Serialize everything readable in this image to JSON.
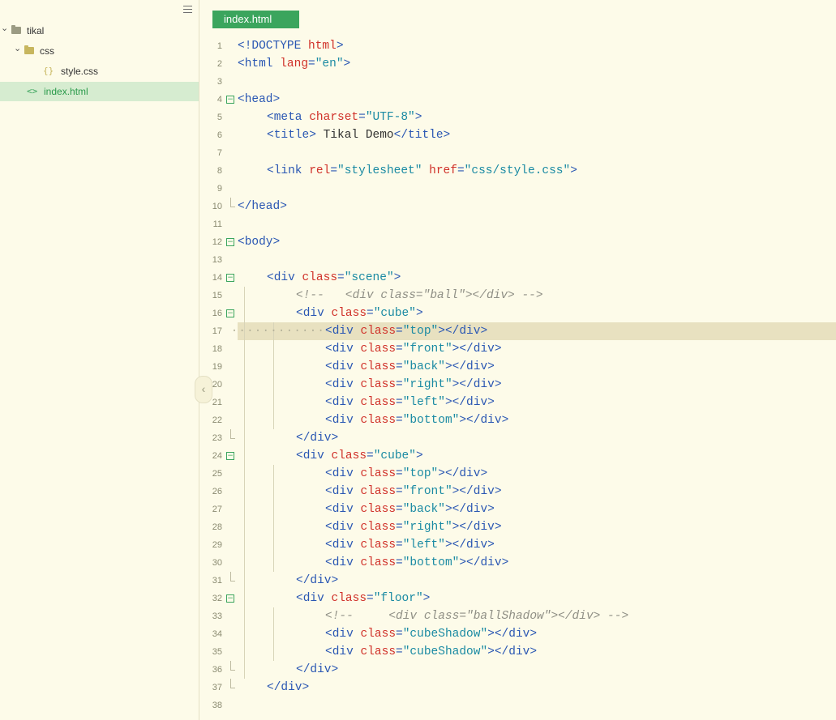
{
  "sidebar": {
    "tree": [
      {
        "label": "tikal",
        "chevron": "⌄",
        "icon": "folder-icon",
        "level": 0
      },
      {
        "label": "css",
        "chevron": "⌄",
        "icon": "folder-open-icon",
        "level": 1
      },
      {
        "label": "style.css",
        "chevron": "",
        "icon": "css-file-icon",
        "glyph": "{}",
        "level": 2
      },
      {
        "label": "index.html",
        "chevron": "",
        "icon": "html-file-icon",
        "glyph": "<>",
        "level": 1,
        "active": true
      }
    ],
    "collapse_glyph": "‹"
  },
  "tab": {
    "label": "index.html"
  },
  "editor": {
    "highlighted_line": 17,
    "lines": [
      {
        "n": "1",
        "indent": 0,
        "tokens": [
          [
            "tag",
            "<!DOCTYPE "
          ],
          [
            "attr",
            "html"
          ],
          [
            "tag",
            ">"
          ]
        ]
      },
      {
        "n": "2",
        "indent": 0,
        "tokens": [
          [
            "tag",
            "<html "
          ],
          [
            "attr",
            "lang"
          ],
          [
            "tag",
            "="
          ],
          [
            "str",
            "\"en\""
          ],
          [
            "tag",
            ">"
          ]
        ]
      },
      {
        "n": "3",
        "indent": 0,
        "tokens": []
      },
      {
        "n": "4",
        "indent": 0,
        "fold": "open",
        "tokens": [
          [
            "tag",
            "<head>"
          ]
        ]
      },
      {
        "n": "5",
        "indent": 1,
        "tokens": [
          [
            "tag",
            "<meta "
          ],
          [
            "attr",
            "charset"
          ],
          [
            "tag",
            "="
          ],
          [
            "str",
            "\"UTF-8\""
          ],
          [
            "tag",
            ">"
          ]
        ]
      },
      {
        "n": "6",
        "indent": 1,
        "tokens": [
          [
            "tag",
            "<title>"
          ],
          [
            "txt",
            " Tikal Demo"
          ],
          [
            "tag",
            "</title>"
          ]
        ]
      },
      {
        "n": "7",
        "indent": 0,
        "tokens": []
      },
      {
        "n": "8",
        "indent": 1,
        "tokens": [
          [
            "tag",
            "<link "
          ],
          [
            "attr",
            "rel"
          ],
          [
            "tag",
            "="
          ],
          [
            "str",
            "\"stylesheet\""
          ],
          [
            "txt",
            " "
          ],
          [
            "attr",
            "href"
          ],
          [
            "tag",
            "="
          ],
          [
            "str",
            "\"css/style.css\""
          ],
          [
            "tag",
            ">"
          ]
        ]
      },
      {
        "n": "9",
        "indent": 0,
        "tokens": []
      },
      {
        "n": "10",
        "indent": 0,
        "fold": "end",
        "tokens": [
          [
            "tag",
            "</head>"
          ]
        ]
      },
      {
        "n": "11",
        "indent": 0,
        "tokens": []
      },
      {
        "n": "12",
        "indent": 0,
        "fold": "open",
        "tokens": [
          [
            "tag",
            "<body>"
          ]
        ]
      },
      {
        "n": "13",
        "indent": 0,
        "tokens": []
      },
      {
        "n": "14",
        "indent": 1,
        "fold": "open",
        "tokens": [
          [
            "tag",
            "<div "
          ],
          [
            "attr",
            "class"
          ],
          [
            "tag",
            "="
          ],
          [
            "str",
            "\"scene\""
          ],
          [
            "tag",
            ">"
          ]
        ]
      },
      {
        "n": "15",
        "indent": 2,
        "tokens": [
          [
            "cmt",
            "<!--   <div class=\"ball\"></div> -->"
          ]
        ]
      },
      {
        "n": "16",
        "indent": 2,
        "fold": "open",
        "tokens": [
          [
            "tag",
            "<div "
          ],
          [
            "attr",
            "class"
          ],
          [
            "tag",
            "="
          ],
          [
            "str",
            "\"cube\""
          ],
          [
            "tag",
            ">"
          ]
        ]
      },
      {
        "n": "17",
        "indent": 3,
        "dots": true,
        "tokens": [
          [
            "tag",
            "<div "
          ],
          [
            "attr",
            "class"
          ],
          [
            "tag",
            "="
          ],
          [
            "str",
            "\"top\""
          ],
          [
            "tag",
            "></div>"
          ]
        ]
      },
      {
        "n": "18",
        "indent": 3,
        "tokens": [
          [
            "tag",
            "<div "
          ],
          [
            "attr",
            "class"
          ],
          [
            "tag",
            "="
          ],
          [
            "str",
            "\"front\""
          ],
          [
            "tag",
            "></div>"
          ]
        ]
      },
      {
        "n": "19",
        "indent": 3,
        "tokens": [
          [
            "tag",
            "<div "
          ],
          [
            "attr",
            "class"
          ],
          [
            "tag",
            "="
          ],
          [
            "str",
            "\"back\""
          ],
          [
            "tag",
            "></div>"
          ]
        ]
      },
      {
        "n": "20",
        "indent": 3,
        "tokens": [
          [
            "tag",
            "<div "
          ],
          [
            "attr",
            "class"
          ],
          [
            "tag",
            "="
          ],
          [
            "str",
            "\"right\""
          ],
          [
            "tag",
            "></div>"
          ]
        ]
      },
      {
        "n": "21",
        "indent": 3,
        "tokens": [
          [
            "tag",
            "<div "
          ],
          [
            "attr",
            "class"
          ],
          [
            "tag",
            "="
          ],
          [
            "str",
            "\"left\""
          ],
          [
            "tag",
            "></div>"
          ]
        ]
      },
      {
        "n": "22",
        "indent": 3,
        "tokens": [
          [
            "tag",
            "<div "
          ],
          [
            "attr",
            "class"
          ],
          [
            "tag",
            "="
          ],
          [
            "str",
            "\"bottom\""
          ],
          [
            "tag",
            "></div>"
          ]
        ]
      },
      {
        "n": "23",
        "indent": 2,
        "fold": "end",
        "tokens": [
          [
            "tag",
            "</div>"
          ]
        ]
      },
      {
        "n": "24",
        "indent": 2,
        "fold": "open",
        "tokens": [
          [
            "tag",
            "<div "
          ],
          [
            "attr",
            "class"
          ],
          [
            "tag",
            "="
          ],
          [
            "str",
            "\"cube\""
          ],
          [
            "tag",
            ">"
          ]
        ]
      },
      {
        "n": "25",
        "indent": 3,
        "tokens": [
          [
            "tag",
            "<div "
          ],
          [
            "attr",
            "class"
          ],
          [
            "tag",
            "="
          ],
          [
            "str",
            "\"top\""
          ],
          [
            "tag",
            "></div>"
          ]
        ]
      },
      {
        "n": "26",
        "indent": 3,
        "tokens": [
          [
            "tag",
            "<div "
          ],
          [
            "attr",
            "class"
          ],
          [
            "tag",
            "="
          ],
          [
            "str",
            "\"front\""
          ],
          [
            "tag",
            "></div>"
          ]
        ]
      },
      {
        "n": "27",
        "indent": 3,
        "tokens": [
          [
            "tag",
            "<div "
          ],
          [
            "attr",
            "class"
          ],
          [
            "tag",
            "="
          ],
          [
            "str",
            "\"back\""
          ],
          [
            "tag",
            "></div>"
          ]
        ]
      },
      {
        "n": "28",
        "indent": 3,
        "tokens": [
          [
            "tag",
            "<div "
          ],
          [
            "attr",
            "class"
          ],
          [
            "tag",
            "="
          ],
          [
            "str",
            "\"right\""
          ],
          [
            "tag",
            "></div>"
          ]
        ]
      },
      {
        "n": "29",
        "indent": 3,
        "tokens": [
          [
            "tag",
            "<div "
          ],
          [
            "attr",
            "class"
          ],
          [
            "tag",
            "="
          ],
          [
            "str",
            "\"left\""
          ],
          [
            "tag",
            "></div>"
          ]
        ]
      },
      {
        "n": "30",
        "indent": 3,
        "tokens": [
          [
            "tag",
            "<div "
          ],
          [
            "attr",
            "class"
          ],
          [
            "tag",
            "="
          ],
          [
            "str",
            "\"bottom\""
          ],
          [
            "tag",
            "></div>"
          ]
        ]
      },
      {
        "n": "31",
        "indent": 2,
        "fold": "end",
        "tokens": [
          [
            "tag",
            "</div>"
          ]
        ]
      },
      {
        "n": "32",
        "indent": 2,
        "fold": "open",
        "tokens": [
          [
            "tag",
            "<div "
          ],
          [
            "attr",
            "class"
          ],
          [
            "tag",
            "="
          ],
          [
            "str",
            "\"floor\""
          ],
          [
            "tag",
            ">"
          ]
        ]
      },
      {
        "n": "33",
        "indent": 3,
        "tokens": [
          [
            "cmt",
            "<!--     <div class=\"ballShadow\"></div> -->"
          ]
        ]
      },
      {
        "n": "34",
        "indent": 3,
        "tokens": [
          [
            "tag",
            "<div "
          ],
          [
            "attr",
            "class"
          ],
          [
            "tag",
            "="
          ],
          [
            "str",
            "\"cubeShadow\""
          ],
          [
            "tag",
            "></div>"
          ]
        ]
      },
      {
        "n": "35",
        "indent": 3,
        "tokens": [
          [
            "tag",
            "<div "
          ],
          [
            "attr",
            "class"
          ],
          [
            "tag",
            "="
          ],
          [
            "str",
            "\"cubeShadow\""
          ],
          [
            "tag",
            "></div>"
          ]
        ]
      },
      {
        "n": "36",
        "indent": 2,
        "fold": "end",
        "tokens": [
          [
            "tag",
            "</div>"
          ]
        ]
      },
      {
        "n": "37",
        "indent": 1,
        "fold": "end",
        "tokens": [
          [
            "tag",
            "</div>"
          ]
        ]
      },
      {
        "n": "38",
        "indent": 0,
        "tokens": []
      }
    ]
  }
}
